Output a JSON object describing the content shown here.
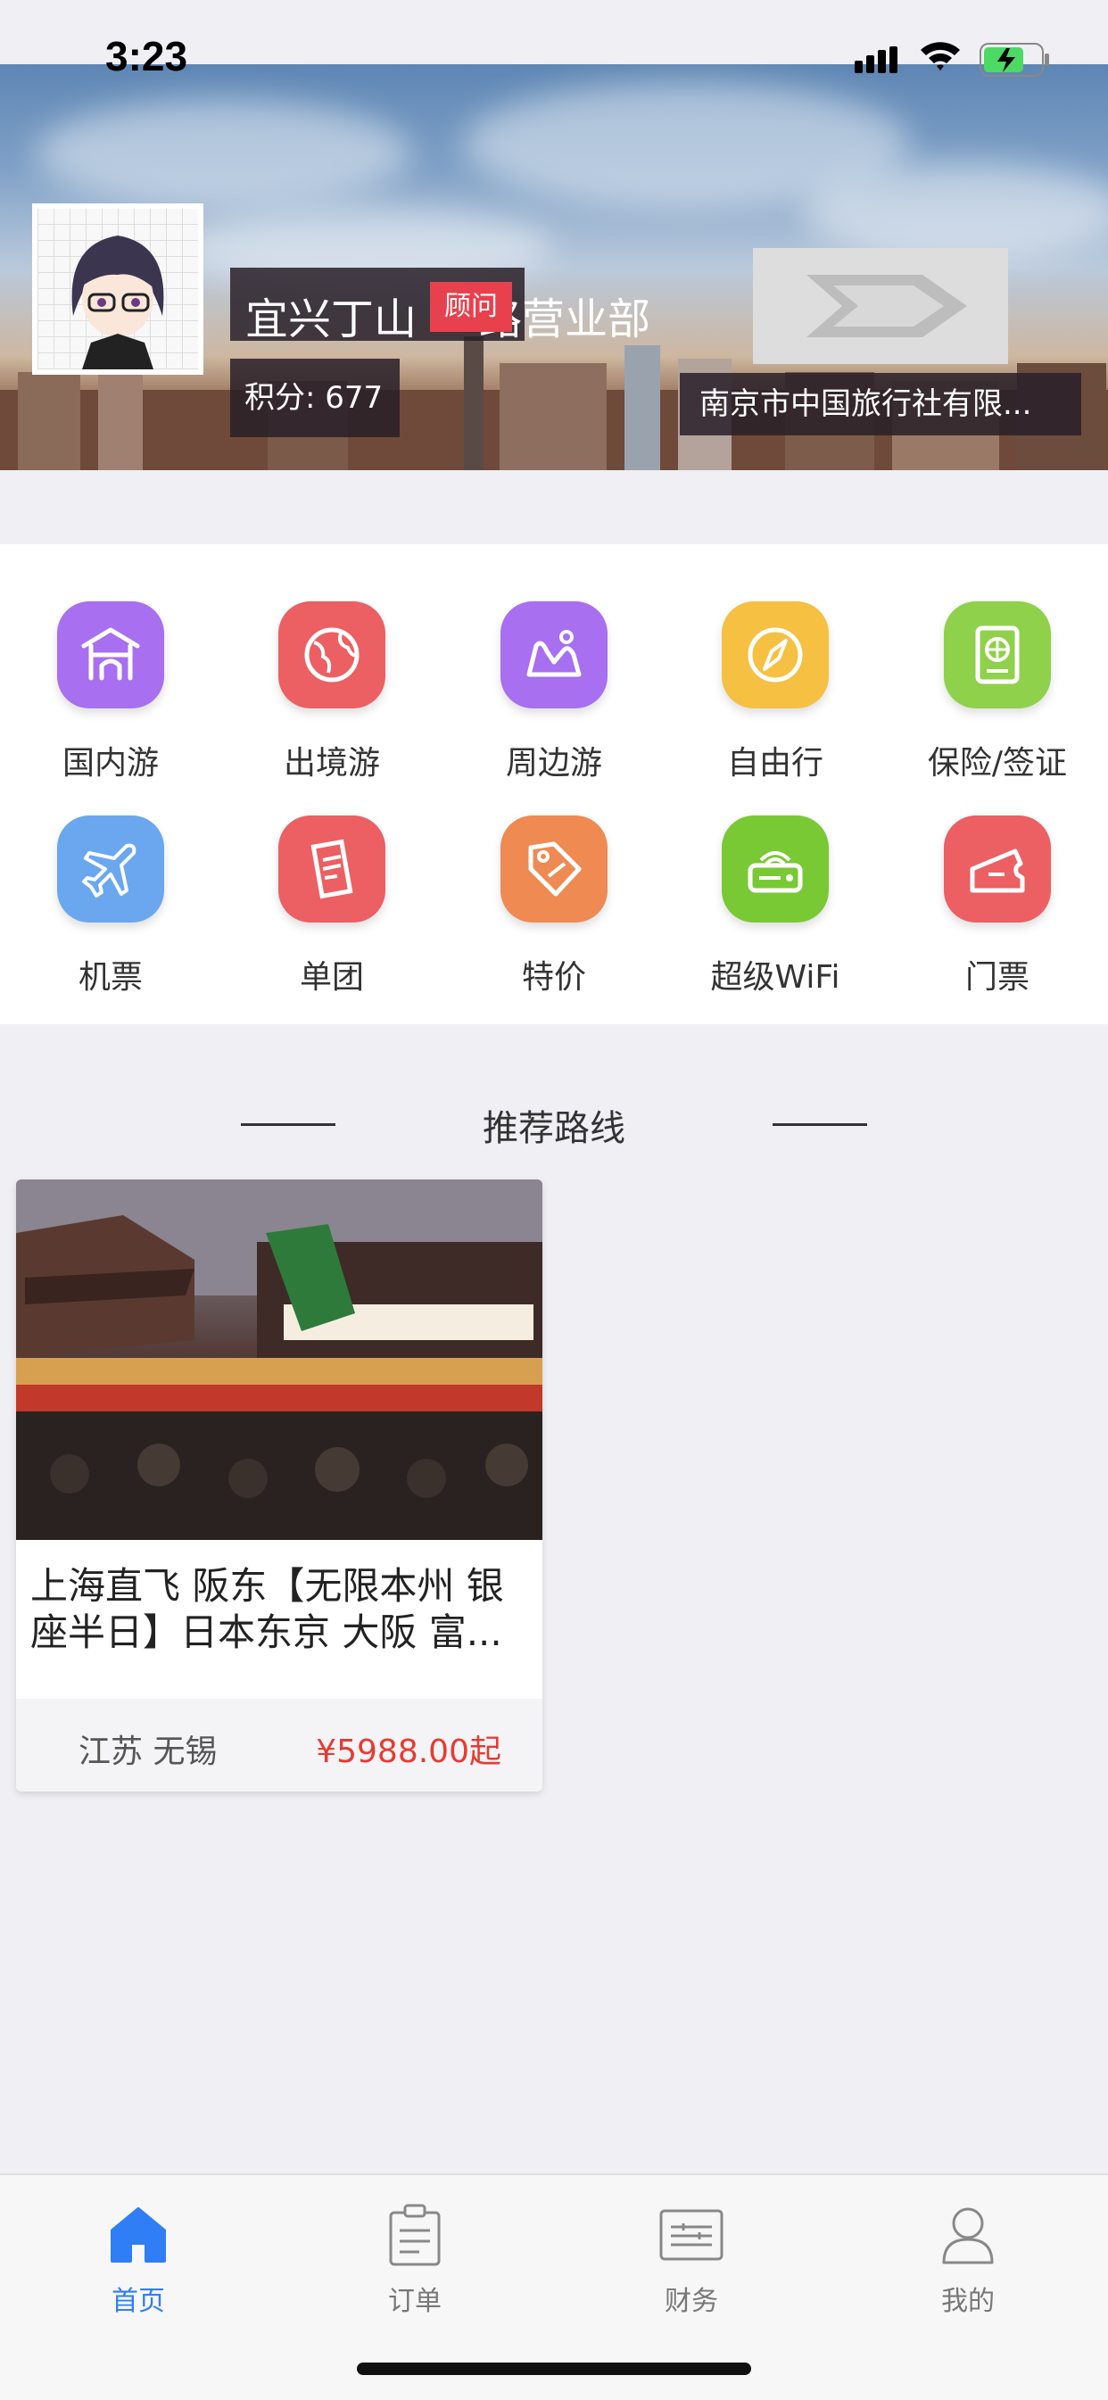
{
  "status_bar": {
    "time": "3:23"
  },
  "profile": {
    "store_name": "宜兴丁山",
    "store_name_suffix": "路营业部",
    "role_badge": "顾问",
    "points_label": "积分: 677",
    "company_name": "南京市中国旅行社有限..."
  },
  "categories": [
    {
      "label": "国内游",
      "icon": "temple-icon",
      "color": "#a86ff0"
    },
    {
      "label": "出境游",
      "icon": "globe-icon",
      "color": "#ec5f62"
    },
    {
      "label": "周边游",
      "icon": "mountain-icon",
      "color": "#a86ff0"
    },
    {
      "label": "自由行",
      "icon": "compass-icon",
      "color": "#f6c042"
    },
    {
      "label": "保险/签证",
      "icon": "passport-icon",
      "color": "#8fd14a"
    },
    {
      "label": "机票",
      "icon": "plane-icon",
      "color": "#6aa7ef"
    },
    {
      "label": "单团",
      "icon": "document-icon",
      "color": "#ec5f62"
    },
    {
      "label": "特价",
      "icon": "price-tag-icon",
      "color": "#ef8a53"
    },
    {
      "label": "超级WiFi",
      "icon": "wifi-router-icon",
      "color": "#79c935"
    },
    {
      "label": "门票",
      "icon": "ticket-icon",
      "color": "#ec5f62"
    }
  ],
  "recommend": {
    "title": "推荐路线",
    "cards": [
      {
        "title": "上海直飞 阪东【无限本州 银座半日】日本东京 大阪  富...",
        "location": "江苏 无锡",
        "price": "¥5988.00起"
      }
    ]
  },
  "tabbar": {
    "active_color": "#2f7ef5",
    "items": [
      {
        "label": "首页",
        "icon": "home-icon"
      },
      {
        "label": "订单",
        "icon": "clipboard-icon"
      },
      {
        "label": "财务",
        "icon": "finance-icon"
      },
      {
        "label": "我的",
        "icon": "user-icon"
      }
    ]
  }
}
